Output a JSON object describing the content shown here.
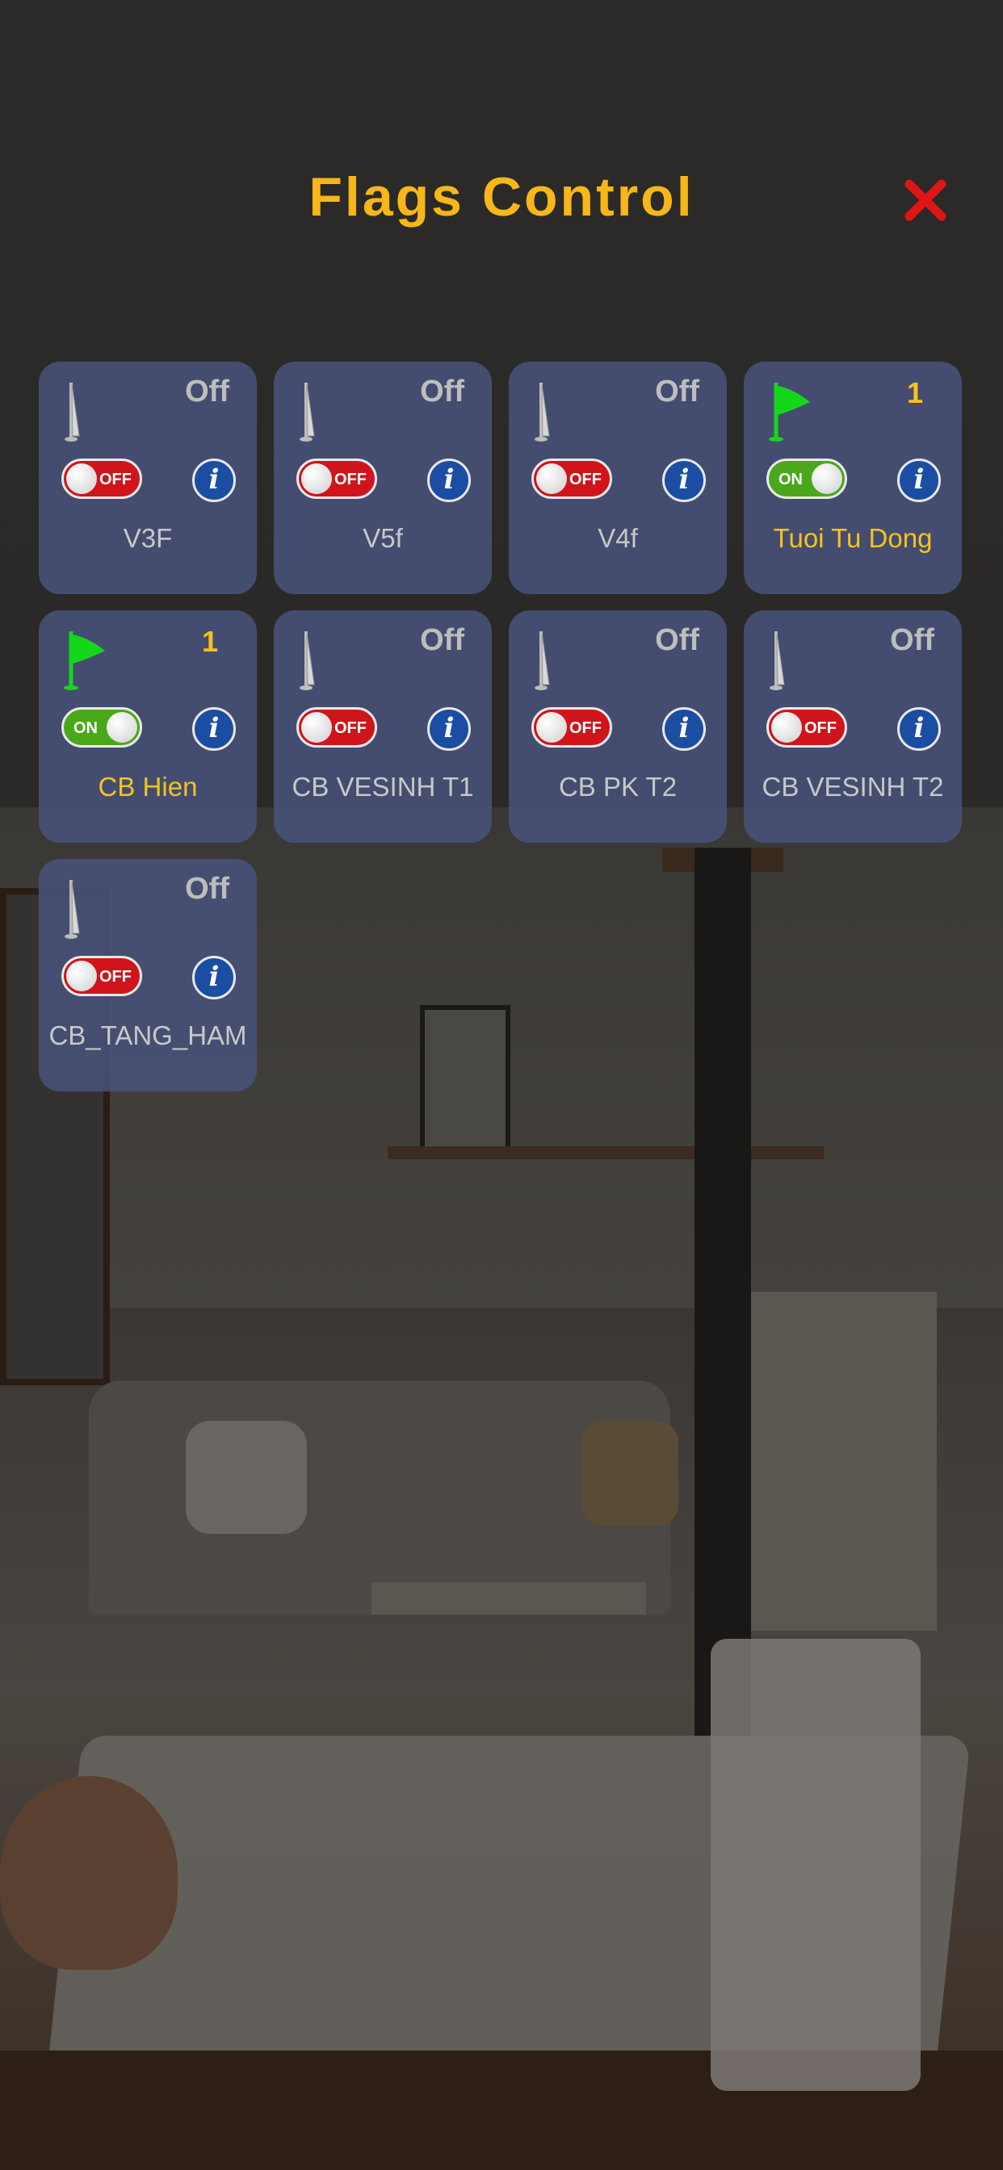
{
  "header": {
    "title": "Flags Control",
    "close_icon": "close-x-icon"
  },
  "colors": {
    "title": "#f7b619",
    "close": "#e01515",
    "card_bg": "#48527a",
    "off_toggle": "#d0141b",
    "on_toggle": "#4aa71a",
    "on_text": "#f7c21c",
    "info_button": "#1b4ea2",
    "flag_on": "#16d61c",
    "flag_off": "#bdbdbd"
  },
  "flags": [
    {
      "name": "V3F",
      "status": "Off",
      "state": "off",
      "toggle_label": "OFF",
      "icon": "flag-pole-icon"
    },
    {
      "name": "V5f",
      "status": "Off",
      "state": "off",
      "toggle_label": "OFF",
      "icon": "flag-pole-icon"
    },
    {
      "name": "V4f",
      "status": "Off",
      "state": "off",
      "toggle_label": "OFF",
      "icon": "flag-pole-icon"
    },
    {
      "name": "Tuoi Tu Dong",
      "status": "1",
      "state": "on",
      "toggle_label": "ON",
      "icon": "green-flag-icon"
    },
    {
      "name": "CB Hien",
      "status": "1",
      "state": "on",
      "toggle_label": "ON",
      "icon": "green-flag-icon"
    },
    {
      "name": "CB VESINH T1",
      "status": "Off",
      "state": "off",
      "toggle_label": "OFF",
      "icon": "flag-pole-icon"
    },
    {
      "name": "CB PK T2",
      "status": "Off",
      "state": "off",
      "toggle_label": "OFF",
      "icon": "flag-pole-icon"
    },
    {
      "name": "CB VESINH T2",
      "status": "Off",
      "state": "off",
      "toggle_label": "OFF",
      "icon": "flag-pole-icon"
    },
    {
      "name": "CB_TANG_HAM",
      "status": "Off",
      "state": "off",
      "toggle_label": "OFF",
      "icon": "flag-pole-icon"
    }
  ],
  "info_glyph": "i"
}
